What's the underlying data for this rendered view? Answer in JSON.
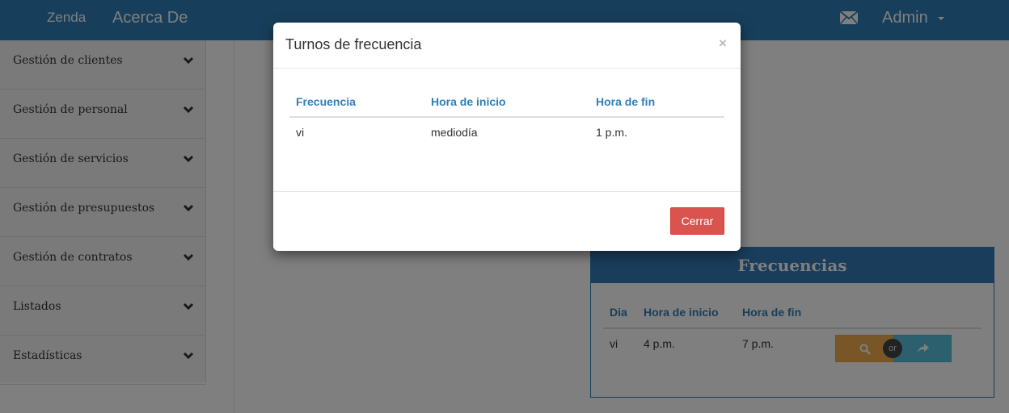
{
  "navbar": {
    "brand": "Zenda",
    "about": "Acerca De",
    "user": "Admin"
  },
  "sidebar": {
    "items": [
      {
        "label": "Gestión de clientes"
      },
      {
        "label": "Gestión de personal"
      },
      {
        "label": "Gestión de servicios"
      },
      {
        "label": "Gestión de presupuestos"
      },
      {
        "label": "Gestión de contratos"
      },
      {
        "label": "Listados"
      },
      {
        "label": "Estadísticas"
      }
    ]
  },
  "panel": {
    "title": "Frecuencias",
    "headers": [
      "Dia",
      "Hora de inicio",
      "Hora de fin"
    ],
    "rows": [
      [
        "vi",
        "4 p.m.",
        "7 p.m."
      ]
    ],
    "or_label": "or"
  },
  "modal": {
    "title": "Turnos de frecuencia",
    "close_glyph": "×",
    "headers": [
      "Frecuencia",
      "Hora de inicio",
      "Hora de fin"
    ],
    "rows": [
      [
        "vi",
        "mediodía",
        "1 p.m."
      ]
    ],
    "close_button": "Cerrar"
  },
  "colors": {
    "primary": "#2f7fb6",
    "warning": "#f0ad4e",
    "info": "#5bc0de",
    "danger": "#d9534f"
  },
  "icons": {
    "mail": "envelope-icon",
    "chevron": "chevron-down-icon",
    "search": "search-icon",
    "share": "share-icon"
  }
}
